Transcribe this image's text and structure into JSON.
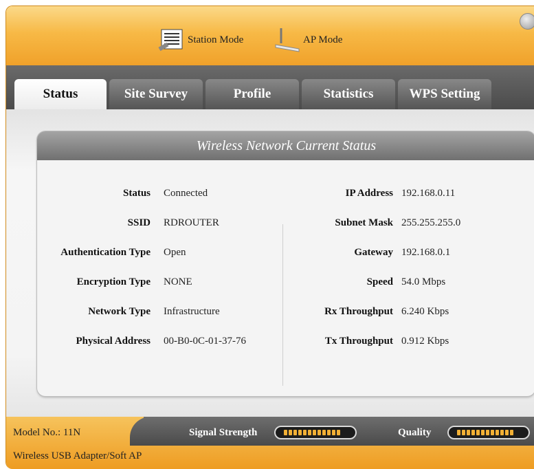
{
  "modes": {
    "station": "Station Mode",
    "ap": "AP Mode"
  },
  "tabs": [
    {
      "label": "Status",
      "active": true
    },
    {
      "label": "Site Survey",
      "active": false
    },
    {
      "label": "Profile",
      "active": false
    },
    {
      "label": "Statistics",
      "active": false
    },
    {
      "label": "WPS Setting",
      "active": false
    }
  ],
  "panel": {
    "title": "Wireless Network Current Status"
  },
  "left": [
    {
      "label": "Status",
      "value": "Connected"
    },
    {
      "label": "SSID",
      "value": "RDROUTER"
    },
    {
      "label": "Authentication Type",
      "value": "Open"
    },
    {
      "label": "Encryption Type",
      "value": "NONE"
    },
    {
      "label": "Network Type",
      "value": "Infrastructure"
    },
    {
      "label": "Physical Address",
      "value": "00-B0-0C-01-37-76"
    }
  ],
  "right": [
    {
      "label": "IP Address",
      "value": "192.168.0.11"
    },
    {
      "label": "Subnet Mask",
      "value": "255.255.255.0"
    },
    {
      "label": "Gateway",
      "value": "192.168.0.1"
    },
    {
      "label": "Speed",
      "value": "54.0 Mbps"
    },
    {
      "label": "Rx Throughput",
      "value": "6.240 Kbps"
    },
    {
      "label": "Tx Throughput",
      "value": "0.912 Kbps"
    }
  ],
  "footer": {
    "model": "Model No.: 11N",
    "product": "Wireless USB Adapter/Soft AP",
    "signal_label": "Signal Strength",
    "quality_label": "Quality",
    "signal_level": 1.0,
    "quality_level": 1.0
  },
  "colors": {
    "accent": "#f0a12a",
    "tab_dark": "#555555",
    "meter_fill": "#f2b035"
  },
  "icons": {
    "station": "wireless-adapter-icon",
    "ap": "access-point-icon",
    "close": "close-icon"
  }
}
